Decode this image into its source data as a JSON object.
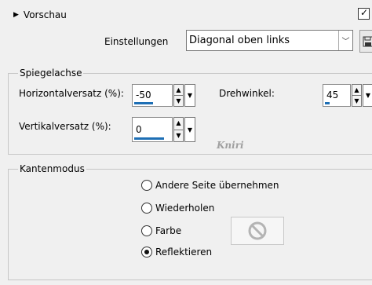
{
  "preview": {
    "label": "Vorschau",
    "checked": true
  },
  "settings": {
    "label": "Einstellungen",
    "selected": "Diagonal oben links"
  },
  "mirror_axis": {
    "title": "Spiegelachse",
    "horizontal_offset": {
      "label": "Horizontalversatz (%):",
      "value": "-50"
    },
    "vertical_offset": {
      "label": "Vertikalversatz (%):",
      "value": "0"
    },
    "rotation_angle": {
      "label": "Drehwinkel:",
      "value": "45"
    }
  },
  "edge_mode": {
    "title": "Kantenmodus",
    "options": [
      {
        "label": "Andere Seite übernehmen",
        "selected": false
      },
      {
        "label": "Wiederholen",
        "selected": false
      },
      {
        "label": "Farbe",
        "selected": false
      },
      {
        "label": "Reflektieren",
        "selected": true
      }
    ]
  },
  "watermark": "Kniri"
}
